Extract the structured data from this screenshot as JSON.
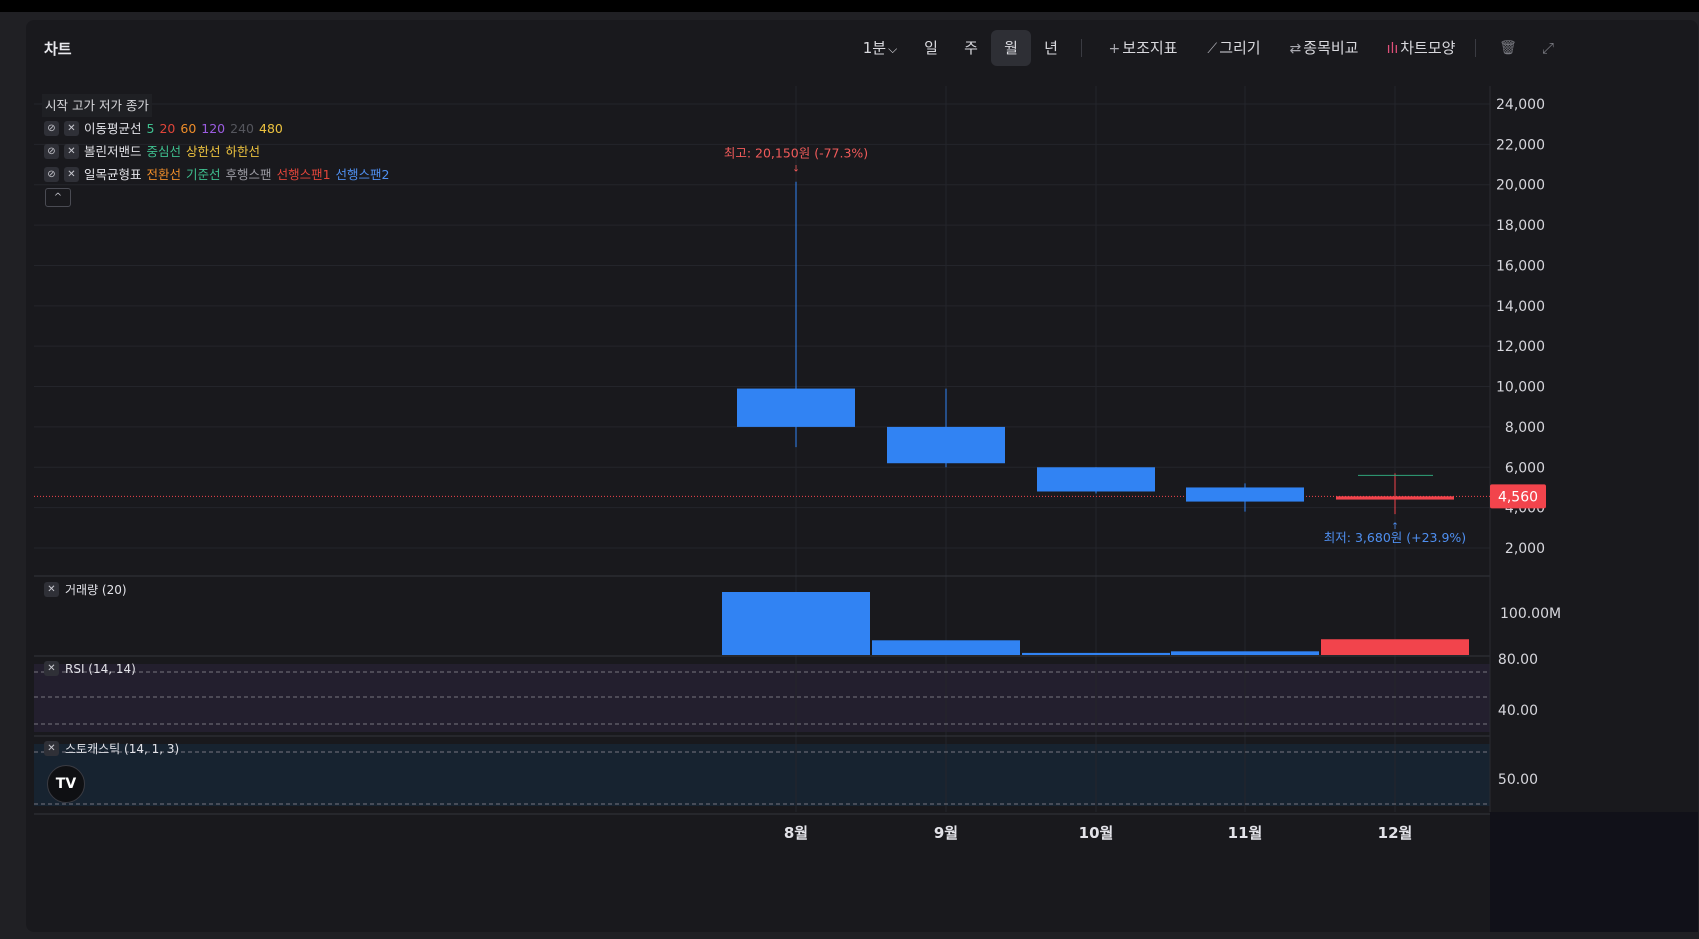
{
  "header": {
    "title": "차트",
    "interval": "1분",
    "periods": [
      "일",
      "주",
      "월",
      "년"
    ],
    "active_period": "월",
    "tools": [
      {
        "icon": "plus-icon",
        "glyph": "+",
        "label": "보조지표"
      },
      {
        "icon": "pencil-icon",
        "glyph": "⟋",
        "label": "그리기"
      },
      {
        "icon": "compare-icon",
        "glyph": "⇄",
        "label": "종목비교"
      },
      {
        "icon": "candle-style-icon",
        "glyph": "ılı",
        "label": "차트모양"
      }
    ],
    "trash_glyph": "🗑",
    "expand_glyph": "⤢"
  },
  "legend": {
    "ohlc": "시작 고가 저가 종가",
    "ma": {
      "name": "이동평균선",
      "periods": [
        {
          "v": "5",
          "c": "#3fbf8f"
        },
        {
          "v": "20",
          "c": "#e0453a"
        },
        {
          "v": "60",
          "c": "#ee8d2a"
        },
        {
          "v": "120",
          "c": "#9b5ce0"
        },
        {
          "v": "240",
          "c": "#55565d"
        },
        {
          "v": "480",
          "c": "#ecc23f"
        }
      ]
    },
    "bb": {
      "name": "볼린저밴드",
      "parts": [
        {
          "v": "중심선",
          "c": "#3fbf8f"
        },
        {
          "v": "상한선",
          "c": "#ecc23f"
        },
        {
          "v": "하한선",
          "c": "#ecc23f"
        }
      ]
    },
    "ichimoku": {
      "name": "일목균형표",
      "parts": [
        {
          "v": "전환선",
          "c": "#ee8d2a"
        },
        {
          "v": "기준선",
          "c": "#3fbf8f"
        },
        {
          "v": "후행스팬",
          "c": "#9a9aa2"
        },
        {
          "v": "선행스팬1",
          "c": "#e0453a"
        },
        {
          "v": "선행스팬2",
          "c": "#4f8ff0"
        }
      ]
    },
    "hide_glyph": "⊘",
    "close_glyph": "✕",
    "collapse_glyph": "^"
  },
  "panes": {
    "volume": "거래량 (20)",
    "rsi": "RSI (14, 14)",
    "stoch": "스토캐스틱 (14, 1, 3)"
  },
  "logo_text": "TV",
  "chart_data": {
    "type": "candlestick",
    "categories": [
      "8월",
      "9월",
      "10월",
      "11월",
      "12월"
    ],
    "candles": [
      {
        "x": "8월",
        "open": 9900,
        "high": 20150,
        "low": 7000,
        "close": 8000
      },
      {
        "x": "9월",
        "open": 8000,
        "high": 9900,
        "low": 6000,
        "close": 6200
      },
      {
        "x": "10월",
        "open": 6000,
        "high": 6000,
        "low": 4700,
        "close": 4800
      },
      {
        "x": "11월",
        "open": 5000,
        "high": 5200,
        "low": 3800,
        "close": 4300
      },
      {
        "x": "12월",
        "open": 4400,
        "high": 5700,
        "low": 3680,
        "close": 4560
      }
    ],
    "price_ticks": [
      "24,000",
      "22,000",
      "20,000",
      "18,000",
      "16,000",
      "14,000",
      "12,000",
      "10,000",
      "8,000",
      "6,000",
      "4,000",
      "2,000"
    ],
    "ylim": [
      0,
      24000
    ],
    "current_price": 4560,
    "current_price_label": "4,560",
    "ma5_value": 5600,
    "high_annotation": "최고: 20,150원 (-77.3%)",
    "low_annotation": "최저: 3,680원 (+23.9%)",
    "volume": {
      "values": [
        120,
        28,
        4,
        7,
        30
      ],
      "colors": [
        "#3183f3",
        "#3183f3",
        "#3183f3",
        "#3183f3",
        "#f2444c"
      ],
      "ticks": [
        "100.00M"
      ]
    },
    "rsi_ticks": [
      "80.00",
      "40.00"
    ],
    "stoch_ticks": [
      "50.00"
    ],
    "colors": {
      "down": "#3183f3",
      "up": "#f2444c",
      "ma5": "#2fa37a"
    },
    "grid": true
  }
}
